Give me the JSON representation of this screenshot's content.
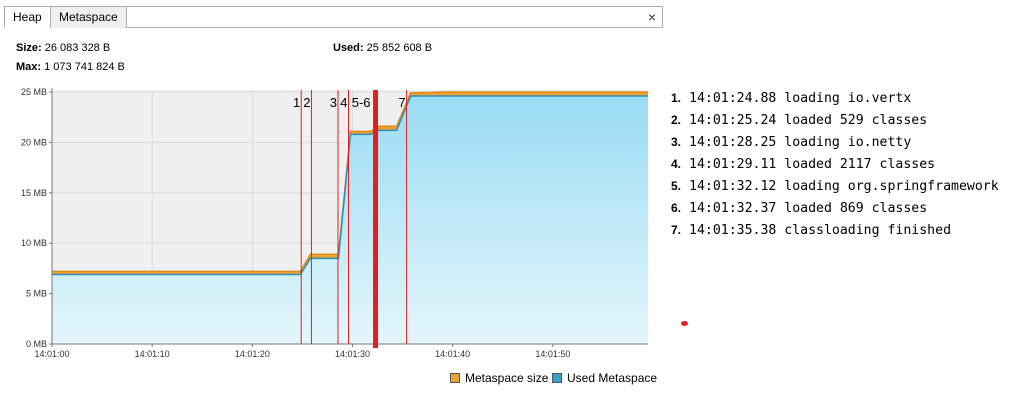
{
  "tabs": [
    {
      "label": "Heap"
    },
    {
      "label": "Metaspace"
    }
  ],
  "close_icon": "×",
  "stats": {
    "size_label": "Size:",
    "size_value": "26 083 328 B",
    "used_label": "Used:",
    "used_value": "25 852 608 B",
    "max_label": "Max:",
    "max_value": "1 073 741 824 B"
  },
  "chart_data": {
    "type": "area",
    "title": "",
    "xlabel": "",
    "ylabel": "",
    "y_ticks": [
      "0 MB",
      "5 MB",
      "10 MB",
      "15 MB",
      "20 MB",
      "25 MB"
    ],
    "x_ticks": [
      "14:01:00",
      "14:01:10",
      "14:01:20",
      "14:01:30",
      "14:01:40",
      "14:01:50"
    ],
    "x_range_seconds": [
      0,
      59.5
    ],
    "ylim_mb": [
      0,
      25.2
    ],
    "grid": true,
    "legend_placement": "bottom-right",
    "colors": {
      "metaspace_size": "#f0a030",
      "used_metaspace": "#3aa0d0",
      "area_fill_top": "#9adcf3",
      "area_fill_bottom": "#e4f6fc",
      "plot_bg": "#f0f0f0",
      "marker_line": "#e02020"
    },
    "series": [
      {
        "name": "Metaspace size",
        "points": [
          [
            0,
            7.2
          ],
          [
            24.8,
            7.2
          ],
          [
            25.8,
            8.9
          ],
          [
            28.6,
            8.9
          ],
          [
            29.8,
            21.1
          ],
          [
            31.8,
            21.1
          ],
          [
            32.6,
            21.6
          ],
          [
            34.4,
            21.6
          ],
          [
            35.8,
            24.9
          ],
          [
            39,
            25.0
          ],
          [
            59.5,
            25.0
          ]
        ]
      },
      {
        "name": "Used Metaspace",
        "points": [
          [
            0,
            6.9
          ],
          [
            24.8,
            6.9
          ],
          [
            25.8,
            8.5
          ],
          [
            28.6,
            8.5
          ],
          [
            29.8,
            20.8
          ],
          [
            31.8,
            20.8
          ],
          [
            32.6,
            21.2
          ],
          [
            34.4,
            21.2
          ],
          [
            35.8,
            24.6
          ],
          [
            39,
            24.6
          ],
          [
            59.5,
            24.6
          ]
        ]
      }
    ],
    "markers": [
      {
        "label": "1",
        "x": 24.88,
        "thick": false
      },
      {
        "label": "2",
        "x": 25.9,
        "thick": false
      },
      {
        "label": "3",
        "x": 28.55,
        "thick": false
      },
      {
        "label": "4",
        "x": 29.6,
        "thick": false
      },
      {
        "label": "5-6",
        "x": 32.3,
        "thick": true
      },
      {
        "label": "7",
        "x": 35.4,
        "thick": false
      }
    ]
  },
  "events": [
    {
      "num": "1.",
      "text": "14:01:24.88  loading io.vertx"
    },
    {
      "num": "2.",
      "text": "14:01:25.24  loaded 529 classes"
    },
    {
      "num": "3.",
      "text": "14:01:28.25  loading io.netty"
    },
    {
      "num": "4.",
      "text": "14:01:29.11  loaded 2117 classes"
    },
    {
      "num": "5.",
      "text": "14:01:32.12  loading org.springframework"
    },
    {
      "num": "6.",
      "text": "14:01:32.37  loaded 869 classes"
    },
    {
      "num": "7.",
      "text": "14:01:35.38  classloading finished"
    }
  ]
}
